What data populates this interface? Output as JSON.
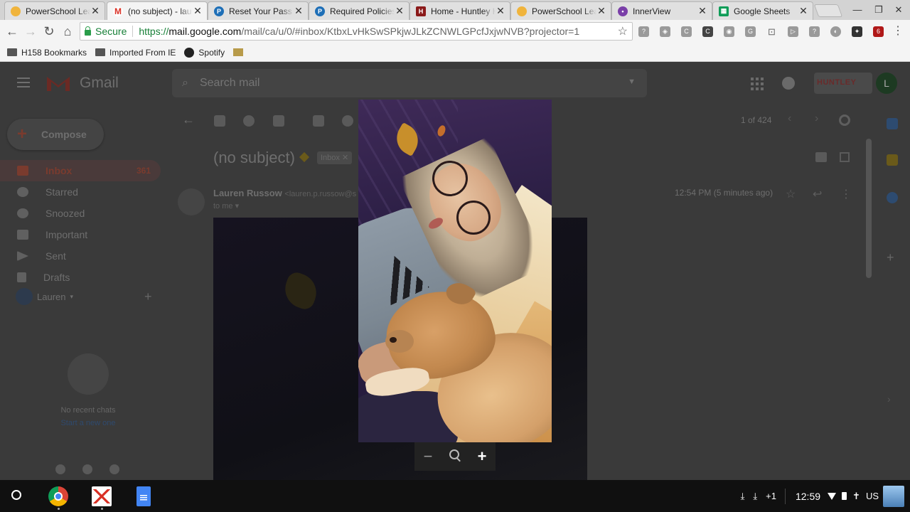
{
  "browser": {
    "tabs": [
      {
        "title": "PowerSchool Lea",
        "favicon": "powerschool-icon",
        "color": "#f0b43c",
        "glyph": ""
      },
      {
        "title": "(no subject) - lau",
        "favicon": "gmail-icon",
        "color": "#ffffff",
        "glyph": "M"
      },
      {
        "title": "Reset Your Pass",
        "favicon": "pearson-icon",
        "color": "#1e6fb7",
        "glyph": "P"
      },
      {
        "title": "Required Policies",
        "favicon": "pearson-icon",
        "color": "#1e6fb7",
        "glyph": "P"
      },
      {
        "title": "Home - Huntley H",
        "favicon": "huntley-icon",
        "color": "#8b1a1a",
        "glyph": "H"
      },
      {
        "title": "PowerSchool Lea",
        "favicon": "powerschool-icon",
        "color": "#f0b43c",
        "glyph": ""
      },
      {
        "title": "InnerView",
        "favicon": "innerview-icon",
        "color": "#7a3fa8",
        "glyph": "•"
      },
      {
        "title": "Google Sheets",
        "favicon": "sheets-icon",
        "color": "#0f9d58",
        "glyph": "▦"
      }
    ],
    "active_tab_index": 1,
    "secure_label": "Secure",
    "url": {
      "scheme": "https://",
      "host": "mail.google.com",
      "path": "/mail/ca/u/0/#inbox/KtbxLvHkSwSPkjwJLkZCNWLGPcfJxjwNVB?projector=1"
    },
    "extensions": [
      "?",
      "◈",
      "C",
      "C",
      "◉",
      "G",
      "⊡",
      "▷",
      "?",
      "◐",
      "✦",
      "6"
    ],
    "bookmarks": [
      {
        "label": "H158 Bookmarks",
        "icon": "folder-icon"
      },
      {
        "label": "Imported From IE",
        "icon": "folder-icon"
      },
      {
        "label": "Spotify",
        "icon": "spotify-icon"
      },
      {
        "label": "",
        "icon": "flag-icon"
      }
    ]
  },
  "gmail": {
    "app_name": "Gmail",
    "search_placeholder": "Search mail",
    "compose_label": "Compose",
    "nav": [
      {
        "label": "Inbox",
        "count": "361",
        "active": true
      },
      {
        "label": "Starred",
        "count": ""
      },
      {
        "label": "Snoozed",
        "count": ""
      },
      {
        "label": "Important",
        "count": ""
      },
      {
        "label": "Sent",
        "count": ""
      },
      {
        "label": "Drafts",
        "count": ""
      }
    ],
    "hangouts_user": "Lauren",
    "no_chats": "No recent chats",
    "start_new": "Start a new one",
    "pager": "1 of 424",
    "org_logo": "HUNTLEY",
    "account_initial": "L",
    "message": {
      "subject": "(no subject)",
      "label_chip": "Inbox",
      "sender_name": "Lauren Russow",
      "sender_email": "<lauren.p.russow@s",
      "to": "to me",
      "time": "12:54 PM (5 minutes ago)"
    }
  },
  "viewer": {
    "zoom_out": "−",
    "zoom_in": "+"
  },
  "shelf": {
    "apps": [
      "chrome-icon",
      "gmail-icon",
      "docs-icon"
    ],
    "notifications": "+1",
    "clock": "12:59",
    "locale": "US"
  },
  "colors": {
    "gmail_red": "#d93025",
    "secure_green": "#188038",
    "overlay_bg": "#3a3a3a"
  }
}
